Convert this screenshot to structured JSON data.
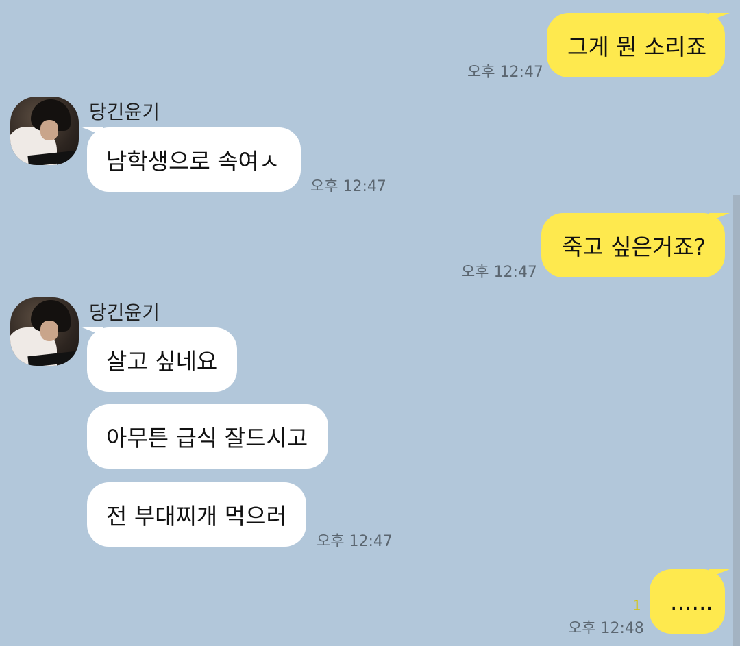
{
  "chat": {
    "messages": [
      {
        "text": "그게 뭔 소리죠",
        "time": "오후 12:47"
      },
      {
        "sender": "당긴윤기",
        "text": "남학생으로 속여ㅅ",
        "time": "오후 12:47"
      },
      {
        "text": "죽고 싶은거죠?",
        "time": "오후 12:47"
      },
      {
        "sender": "당긴윤기",
        "texts": [
          "살고 싶네요",
          "아무튼 급식 잘드시고",
          "전 부대찌개 먹으러"
        ],
        "time": "오후 12:47"
      },
      {
        "text": "......",
        "time": "오후 12:48",
        "unread": "1"
      }
    ]
  },
  "colors": {
    "background": "#b2c7da",
    "my_bubble": "#fee94e",
    "their_bubble": "#ffffff",
    "unread": "#d9c400"
  }
}
